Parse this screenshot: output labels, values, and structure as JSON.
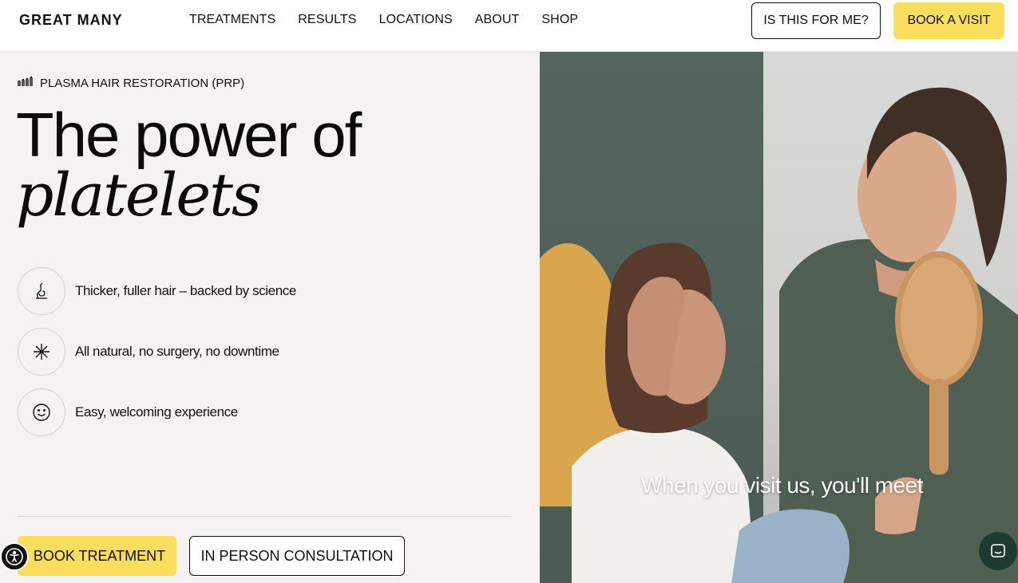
{
  "header": {
    "logo": "GREAT MANY",
    "nav": [
      "TREATMENTS",
      "RESULTS",
      "LOCATIONS",
      "ABOUT",
      "SHOP"
    ],
    "is_this_for_me": "IS THIS FOR ME?",
    "book_visit": "BOOK A VISIT"
  },
  "hero": {
    "eyebrow": "PLASMA HAIR RESTORATION (PRP)",
    "headline_line1": "The power of",
    "headline_line2": "platelets",
    "features": [
      {
        "icon": "hair-strand-icon",
        "text": "Thicker, fuller hair – backed by science"
      },
      {
        "icon": "sparkle-icon",
        "text": "All natural, no surgery, no downtime"
      },
      {
        "icon": "smiley-icon",
        "text": "Easy, welcoming experience"
      }
    ],
    "book_treatment": "BOOK TREATMENT",
    "consultation": "IN PERSON CONSULTATION"
  },
  "video": {
    "caption": "When you visit us, you'll meet"
  },
  "colors": {
    "accent_yellow": "#fbde5e",
    "background": "#f4f3f1",
    "chat_green": "#1e3b30"
  }
}
